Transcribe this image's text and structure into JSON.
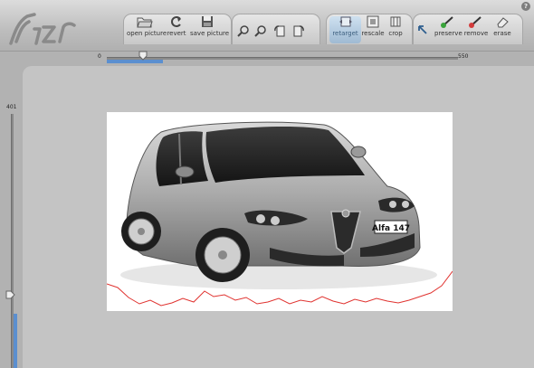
{
  "app": {
    "logo_text": "Sizr"
  },
  "toolbar": {
    "open_picture": "open picture",
    "revert": "revert",
    "save_picture": "save picture",
    "retarget": "retarget",
    "rescale": "rescale",
    "crop": "crop",
    "preserve": "preserve",
    "remove": "remove",
    "erase": "erase",
    "help": "?"
  },
  "width_slider": {
    "min": "0",
    "max": "550",
    "value": 0.16
  },
  "height_slider": {
    "max": "401",
    "value": 0.2
  },
  "image": {
    "plate_text": "Alfa 147",
    "description_icon": "car-photo"
  },
  "colors": {
    "accent": "#5b8fcf",
    "seam_line": "#e0322f",
    "toolbar_bg": "#c8c8c8"
  }
}
